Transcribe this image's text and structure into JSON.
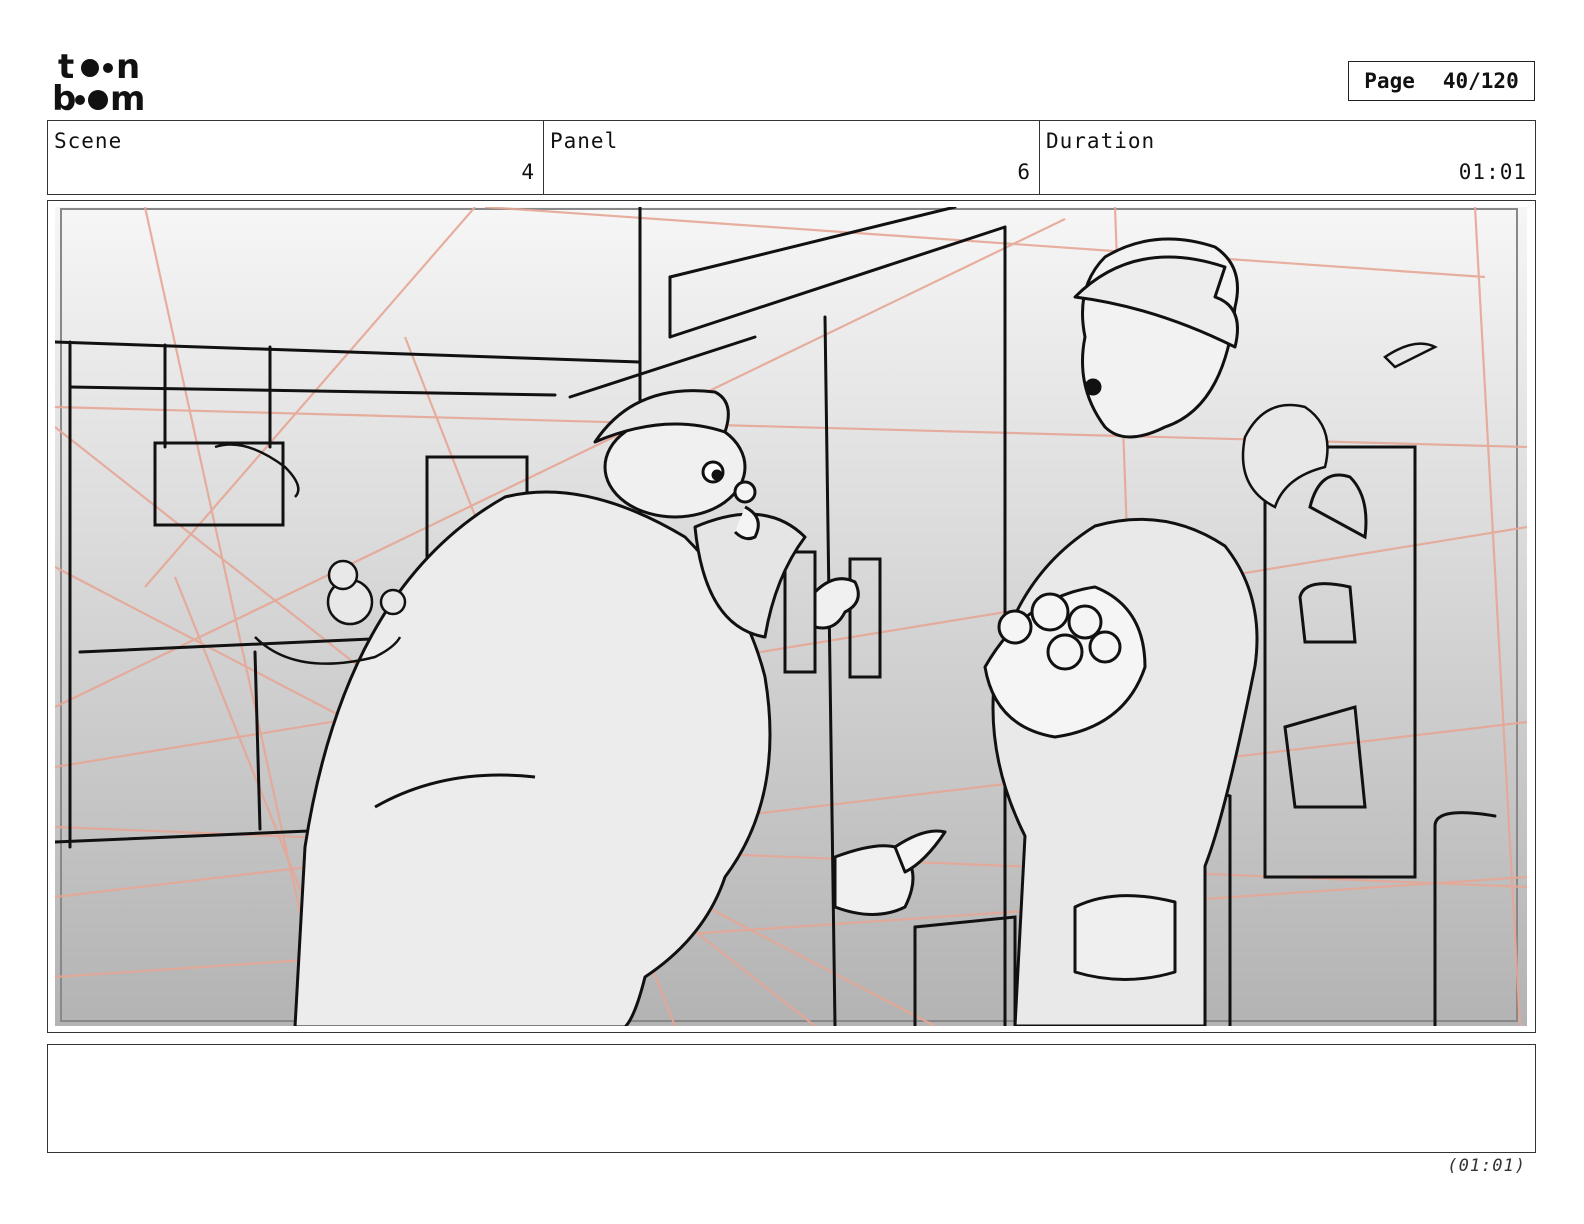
{
  "logo": {
    "line1": "toon",
    "line2": "boom"
  },
  "page": {
    "label": "Page",
    "value": "40/120"
  },
  "header": {
    "scene": {
      "label": "Scene",
      "value": "4"
    },
    "panel": {
      "label": "Panel",
      "value": "6"
    },
    "duration": {
      "label": "Duration",
      "value": "01:01"
    }
  },
  "caption": {
    "text": ""
  },
  "footer": {
    "duration": "(01:01)"
  },
  "colors": {
    "guide_lines": "#e6a796",
    "ink": "#111111",
    "frame": "#333333"
  },
  "panel_image": {
    "icon": "storyboard-sketch-icon"
  }
}
